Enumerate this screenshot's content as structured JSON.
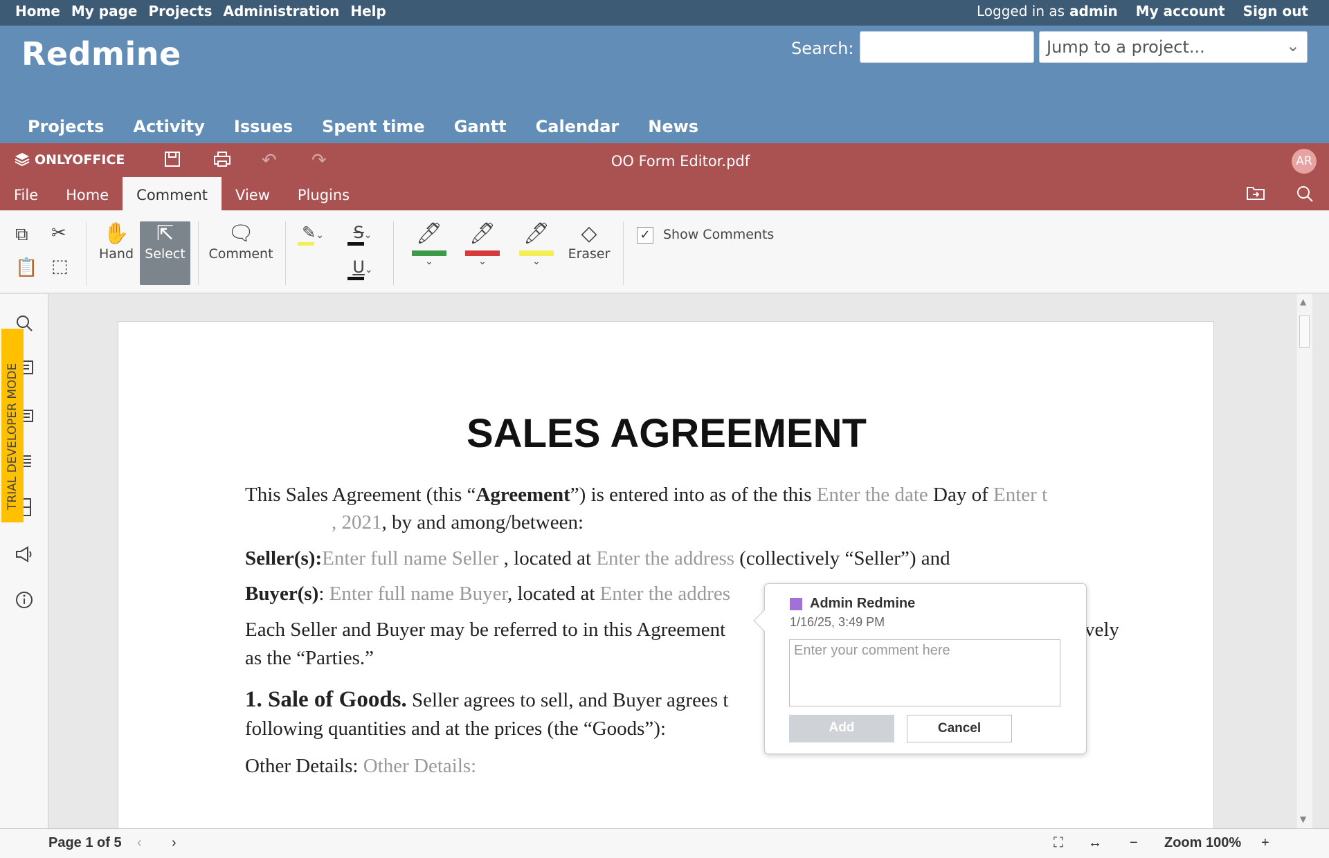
{
  "redmine": {
    "top_links": [
      "Home",
      "My page",
      "Projects",
      "Administration",
      "Help"
    ],
    "logged_in_label": "Logged in as",
    "logged_in_user": "admin",
    "my_account": "My account",
    "sign_out": "Sign out",
    "logo": "Redmine",
    "search_label": "Search:",
    "search_value": "",
    "jump_placeholder": "Jump to a project...",
    "main_menu": [
      "Projects",
      "Activity",
      "Issues",
      "Spent time",
      "Gantt",
      "Calendar",
      "News"
    ]
  },
  "editor": {
    "brand": "ONLYOFFICE",
    "document_title": "OO Form Editor.pdf",
    "avatar_initials": "AR",
    "tabs": [
      "File",
      "Home",
      "Comment",
      "View",
      "Plugins"
    ],
    "active_tab": "Comment",
    "toolbar": {
      "hand": "Hand",
      "select": "Select",
      "comment": "Comment",
      "eraser": "Eraser",
      "show_comments": "Show Comments",
      "show_comments_checked": true,
      "pen_colors": [
        "#3c9a48",
        "#d63a3a",
        "#f4ee57"
      ],
      "highlight_color": "#f4ee57"
    }
  },
  "trial_banner": "TRIAL DEVELOPER MODE",
  "document": {
    "heading": "SALES AGREEMENT",
    "p1_a": "This Sales Agreement (this “",
    "p1_b": "Agreement",
    "p1_c": "”) is entered into as of the this ",
    "p1_date": "Enter the date",
    "p1_d": " Day of ",
    "p1_e": "Enter t",
    "p1_line2_year": ", 2021",
    "p1_line2_rest": ",  by and among/between:",
    "seller_label": "Seller(s):",
    "seller_name": "Enter full name Seller",
    "seller_located": " , located at ",
    "seller_address": "Enter the address",
    "seller_rest": "  (collectively “Seller”) and",
    "buyer_label": "Buyer(s)",
    "buyer_colon": ": ",
    "buyer_name": "Enter full name Buyer",
    "buyer_located": ", located at ",
    "buyer_address": "Enter the addres",
    "each_line1": "Each Seller and Buyer may be referred to in this Agreement",
    "each_tail": "vely",
    "each_line2": "as the “Parties.”",
    "sale_heading": "1. Sale of Goods.",
    "sale_text": " Seller agrees to sell, and Buyer agrees t",
    "sale_line2": "following quantities and at the prices (the “Goods”):",
    "other_label": "Other Details: ",
    "other_value": "Other Details:"
  },
  "comment_popup": {
    "author": "Admin Redmine",
    "author_color": "#a36fd8",
    "date": "1/16/25, 3:49 PM",
    "placeholder": "Enter your comment here",
    "add_label": "Add",
    "cancel_label": "Cancel"
  },
  "status_bar": {
    "page_info": "Page 1 of 5",
    "zoom": "Zoom 100%"
  }
}
